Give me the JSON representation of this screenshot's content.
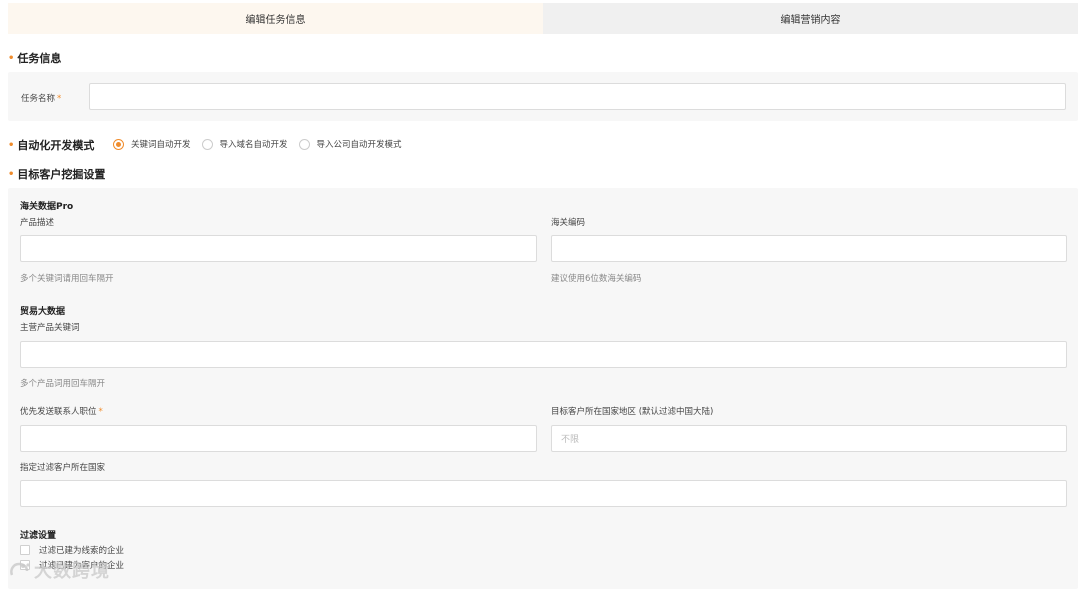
{
  "tabs": [
    {
      "label": "编辑任务信息",
      "active": true
    },
    {
      "label": "编辑营销内容",
      "active": false
    }
  ],
  "task_info": {
    "title": "任务信息",
    "name_label": "任务名称",
    "required_mark": "*",
    "name_value": ""
  },
  "auto_mode": {
    "title": "自动化开发模式",
    "options": [
      {
        "label": "关键词自动开发",
        "checked": true
      },
      {
        "label": "导入域名自动开发",
        "checked": false
      },
      {
        "label": "导入公司自动开发模式",
        "checked": false
      }
    ]
  },
  "target": {
    "title": "目标客户挖掘设置",
    "customs": {
      "heading": "海关数据Pro",
      "product_desc_label": "产品描述",
      "product_desc_value": "",
      "product_desc_hint": "多个关键词请用回车隔开",
      "hs_code_label": "海关编码",
      "hs_code_value": "",
      "hs_code_hint": "建议使用6位数海关编码"
    },
    "trade": {
      "heading": "贸易大数据",
      "keywords_label": "主营产品关键词",
      "keywords_value": "",
      "keywords_hint": "多个产品词用回车隔开"
    },
    "contact_position_label": "优先发送联系人职位",
    "contact_position_value": "",
    "region_label": "目标客户所在国家地区 (默认过滤中国大陆)",
    "region_placeholder": "不限",
    "filter_country_label": "指定过滤客户所在国家",
    "filter_country_value": "",
    "filter": {
      "heading": "过滤设置",
      "options": [
        {
          "label": "过滤已建为线索的企业",
          "checked": false
        },
        {
          "label": "过滤已建为客户的企业",
          "checked": false
        }
      ]
    }
  },
  "watermark_text": "大数跨境",
  "colors": {
    "accent": "#f08c2c",
    "panel": "#f7f7f7",
    "tab_active": "#fdf7ef",
    "tab_inactive": "#f0f0f0"
  }
}
